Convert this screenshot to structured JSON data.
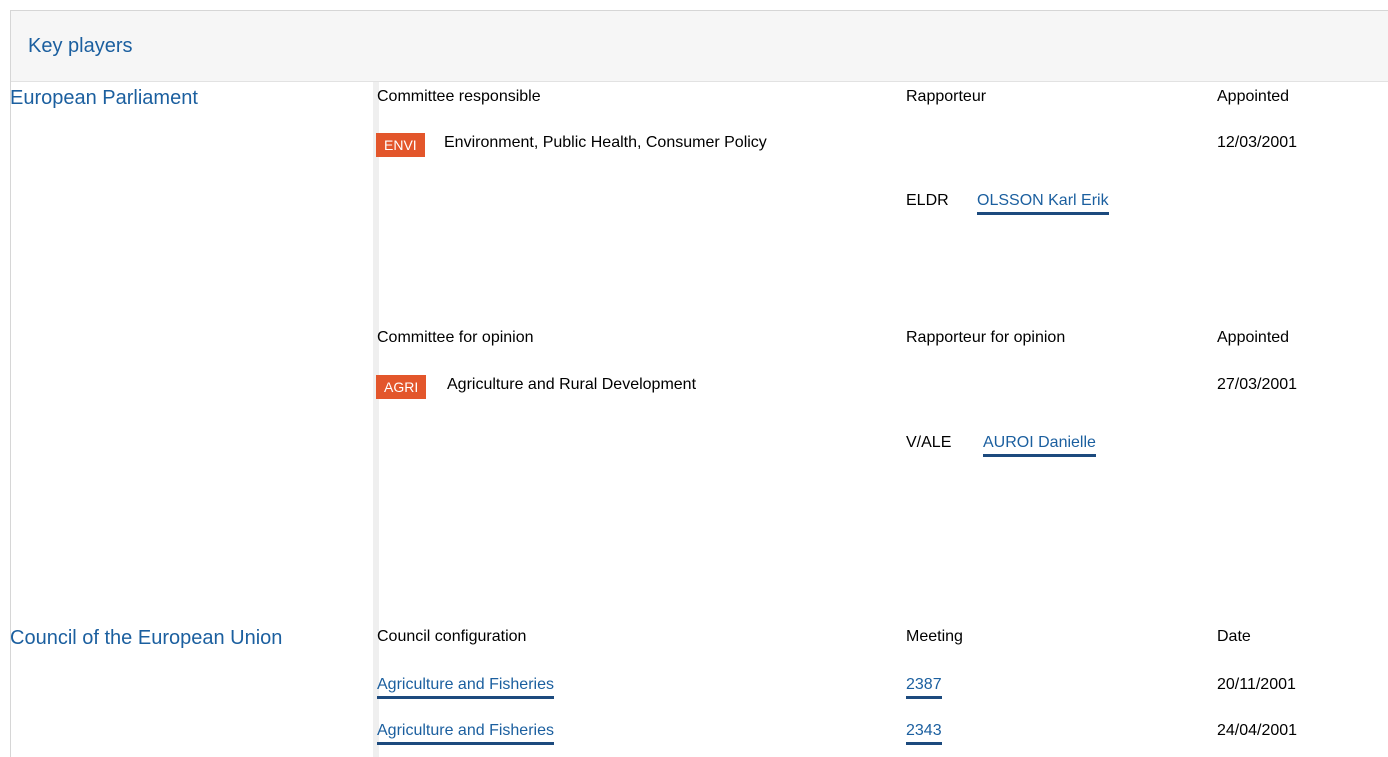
{
  "header": {
    "title": "Key players"
  },
  "ep": {
    "name": "European Parliament",
    "responsible": {
      "col_committee": "Committee responsible",
      "col_rapporteur": "Rapporteur",
      "col_appointed": "Appointed",
      "badge": "ENVI",
      "committee": "Environment, Public Health, Consumer Policy",
      "date": "12/03/2001",
      "group": "ELDR",
      "rapporteur": "OLSSON Karl Erik"
    },
    "opinion": {
      "col_committee": "Committee for opinion",
      "col_rapporteur": "Rapporteur for opinion",
      "col_appointed": "Appointed",
      "badge": "AGRI",
      "committee": "Agriculture and Rural Development",
      "date": "27/03/2001",
      "group": "V/ALE",
      "rapporteur": "AUROI Danielle"
    }
  },
  "council": {
    "name": "Council of the European Union",
    "col_configuration": "Council configuration",
    "col_meeting": "Meeting",
    "col_date": "Date",
    "rows": [
      {
        "configuration": "Agriculture and Fisheries",
        "meeting": "2387",
        "date": "20/11/2001"
      },
      {
        "configuration": "Agriculture and Fisheries",
        "meeting": "2343",
        "date": "24/04/2001"
      }
    ]
  },
  "colors": {
    "link": "#1b5f9f",
    "badge": "#e3562b",
    "underline": "#1c4a7e"
  }
}
